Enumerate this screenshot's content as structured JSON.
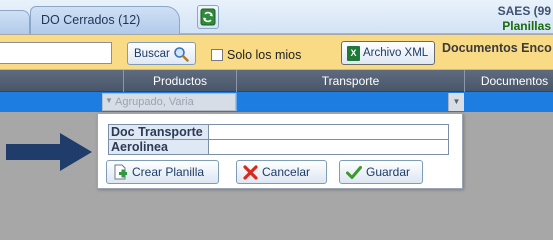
{
  "tabs": [
    {
      "label": "DO Cerrados (12)"
    }
  ],
  "header": {
    "company_line1": "SAES (99",
    "company_line2": "Planillas"
  },
  "toolbar": {
    "search_value": "",
    "search_label": "Buscar",
    "only_mine_label": "Solo los mios",
    "only_mine_checked": false,
    "xml_label": "Archivo XML",
    "docs_title": "Documentos Enco"
  },
  "grid": {
    "columns": [
      "",
      "Productos",
      "Transporte",
      "Documentos"
    ],
    "selected_row": {
      "productos_value": "Agrupado, Varia"
    }
  },
  "popup": {
    "fields": [
      {
        "label": "Doc Transporte",
        "value": ""
      },
      {
        "label": "Aerolinea",
        "value": ""
      }
    ],
    "buttons": {
      "create_label": "Crear Planilla",
      "cancel_label": "Cancelar",
      "save_label": "Guardar"
    }
  },
  "colors": {
    "toolbar_bg": "#f9da85",
    "grid_header_bg": "#4f5a6c",
    "selected_row_bg": "#1e7de0",
    "arrow_color": "#1f3c6b",
    "company_line2_color": "#1a6a0c"
  },
  "icons": {
    "refresh": "refresh-icon",
    "search": "magnifier-icon",
    "xml": "excel-icon",
    "create": "add-document-icon",
    "cancel": "red-x-icon",
    "save": "checkmark-icon",
    "pointer": "right-arrow-icon"
  }
}
